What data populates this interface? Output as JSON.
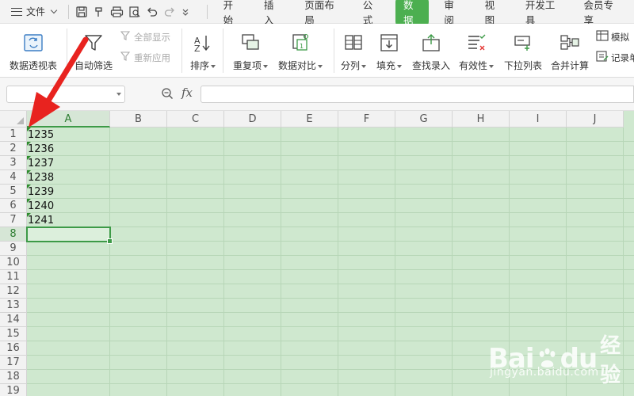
{
  "menubar": {
    "file_label": "文件",
    "tabs": [
      "开始",
      "插入",
      "页面布局",
      "公式",
      "数据",
      "审阅",
      "视图",
      "开发工具",
      "会员专享"
    ],
    "active_tab": "数据"
  },
  "ribbon": {
    "pivot": "数据透视表",
    "autofilter": "自动筛选",
    "show_all": "全部显示",
    "reapply": "重新应用",
    "sort": "排序",
    "duplicates": "重复项",
    "compare": "数据对比",
    "split": "分列",
    "fill": "填充",
    "lookup": "查找录入",
    "validity": "有效性",
    "dropdown": "下拉列表",
    "consolidate": "合并计算",
    "simulate": "模拟",
    "record": "记录单"
  },
  "formula": {
    "fx_label": "fx"
  },
  "grid": {
    "columns": [
      "A",
      "B",
      "C",
      "D",
      "E",
      "F",
      "G",
      "H",
      "I",
      "J"
    ],
    "rows": [
      "1",
      "2",
      "3",
      "4",
      "5",
      "6",
      "7",
      "8",
      "9",
      "10",
      "11",
      "12",
      "13",
      "14",
      "15",
      "16",
      "17",
      "18",
      "19"
    ],
    "cells_a": [
      "1235",
      "1236",
      "1237",
      "1238",
      "1239",
      "1240",
      "1241"
    ],
    "active_column": "A",
    "active_row": "8"
  },
  "watermark": {
    "logo_left": "Bai",
    "logo_right": "du",
    "logo_cn": "经验",
    "url": "jingyan.baidu.com"
  },
  "colors": {
    "accent": "#4caf50",
    "sheet_bg": "#cfe8cf",
    "arrow": "#e8231f"
  }
}
